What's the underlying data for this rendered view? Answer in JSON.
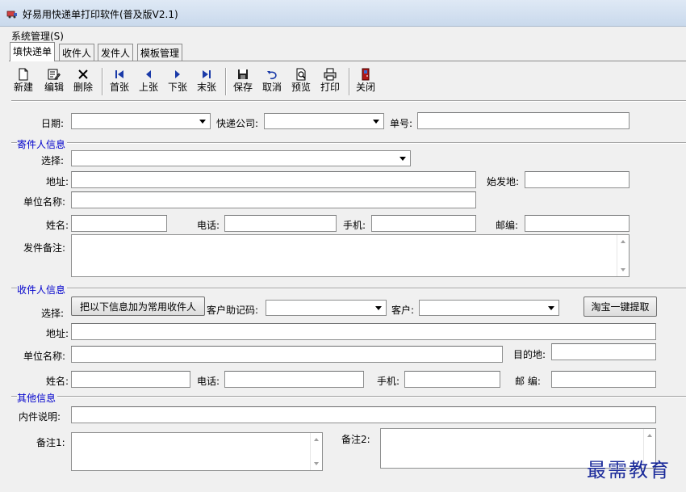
{
  "window": {
    "title": "好易用快递单打印软件(普及版V2.1)"
  },
  "menu": {
    "system": "系统管理(S)"
  },
  "tabs": [
    {
      "label": "填快递单",
      "active": true
    },
    {
      "label": "收件人",
      "active": false
    },
    {
      "label": "发件人",
      "active": false
    },
    {
      "label": "模板管理",
      "active": false
    }
  ],
  "toolbar": {
    "new": "新建",
    "edit": "编辑",
    "delete": "删除",
    "first": "首张",
    "prev": "上张",
    "next": "下张",
    "last": "末张",
    "save": "保存",
    "cancel": "取消",
    "preview": "预览",
    "print": "打印",
    "close": "关闭"
  },
  "top": {
    "date_label": "日期:",
    "date_value": "",
    "courier_label": "快递公司:",
    "courier_value": "",
    "number_label": "单号:",
    "number_value": ""
  },
  "sender": {
    "section_title": "寄件人信息",
    "select_label": "选择:",
    "select_value": "",
    "address_label": "地址:",
    "address_value": "",
    "origin_label": "始发地:",
    "origin_value": "",
    "company_label": "单位名称:",
    "company_value": "",
    "name_label": "姓名:",
    "name_value": "",
    "phone_label": "电话:",
    "phone_value": "",
    "mobile_label": "手机:",
    "mobile_value": "",
    "zip_label": "邮编:",
    "zip_value": "",
    "note_label": "发件备注:",
    "note_value": ""
  },
  "recipient": {
    "section_title": "收件人信息",
    "select_label": "选择:",
    "add_common_button": "把以下信息加为常用收件人",
    "mnemonic_label": "客户助记码:",
    "mnemonic_value": "",
    "customer_label": "客户:",
    "customer_value": "",
    "taobao_button": "淘宝一键提取",
    "address_label": "地址:",
    "address_value": "",
    "company_label": "单位名称:",
    "company_value": "",
    "destination_label": "目的地:",
    "destination_value": "",
    "name_label": "姓名:",
    "name_value": "",
    "phone_label": "电话:",
    "phone_value": "",
    "mobile_label": "手机:",
    "mobile_value": "",
    "zip_label": "邮 编:",
    "zip_value": ""
  },
  "other": {
    "section_title": "其他信息",
    "contents_label": "内件说明:",
    "contents_value": "",
    "note1_label": "备注1:",
    "note1_value": "",
    "note2_label": "备注2:",
    "note2_value": ""
  },
  "watermark": "最需教育"
}
